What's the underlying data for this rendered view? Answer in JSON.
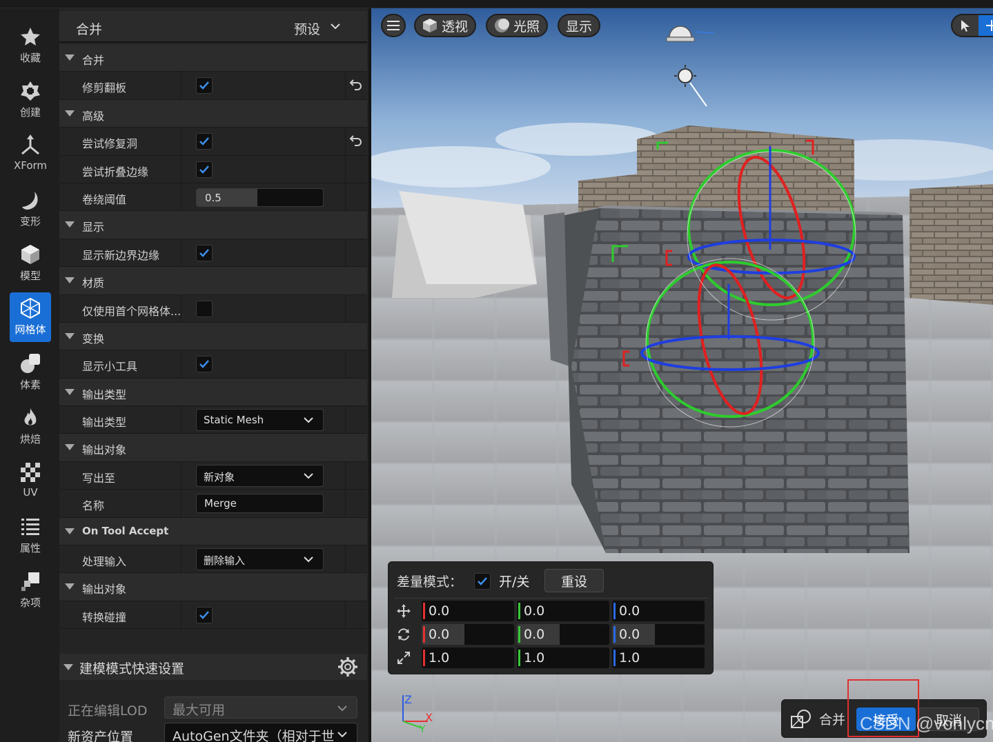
{
  "modes": [
    {
      "label": "收藏",
      "icon": "star-icon"
    },
    {
      "label": "创建",
      "icon": "create-icon"
    },
    {
      "label": "XForm",
      "icon": "xform-icon"
    },
    {
      "label": "变形",
      "icon": "deform-icon"
    },
    {
      "label": "模型",
      "icon": "model-icon"
    },
    {
      "label": "网格体",
      "icon": "mesh-icon",
      "active": true
    },
    {
      "label": "体素",
      "icon": "voxel-icon"
    },
    {
      "label": "烘焙",
      "icon": "bake-icon"
    },
    {
      "label": "UV",
      "icon": "uv-icon"
    },
    {
      "label": "属性",
      "icon": "attributes-icon"
    },
    {
      "label": "杂项",
      "icon": "misc-icon"
    }
  ],
  "panel": {
    "title": "合并",
    "preset_label": "预设",
    "rows": [
      {
        "type": "category",
        "label": "合并"
      },
      {
        "type": "checkbox",
        "label": "修剪翻板",
        "checked": true,
        "reset": true
      },
      {
        "type": "category",
        "label": "高级"
      },
      {
        "type": "checkbox",
        "label": "尝试修复洞",
        "checked": true,
        "reset": true
      },
      {
        "type": "checkbox",
        "label": "尝试折叠边缘",
        "checked": true
      },
      {
        "type": "number",
        "label": "卷绕阈值",
        "value": "0.5",
        "fraction": 0.48
      },
      {
        "type": "category",
        "label": "显示"
      },
      {
        "type": "checkbox",
        "label": "显示新边界边缘",
        "checked": true
      },
      {
        "type": "category",
        "label": "材质"
      },
      {
        "type": "checkbox",
        "label": "仅使用首个网格体...",
        "checked": false
      },
      {
        "type": "category",
        "label": "变换"
      },
      {
        "type": "checkbox",
        "label": "显示小工具",
        "checked": true
      },
      {
        "type": "category",
        "label": "输出类型"
      },
      {
        "type": "combo",
        "label": "输出类型",
        "value": "Static Mesh"
      },
      {
        "type": "category",
        "label": "输出对象"
      },
      {
        "type": "combo",
        "label": "写出至",
        "value": "新对象"
      },
      {
        "type": "text",
        "label": "名称",
        "value": "Merge"
      },
      {
        "type": "category",
        "label": "On Tool Accept",
        "bold": true
      },
      {
        "type": "combo",
        "label": "处理输入",
        "value": "删除输入"
      },
      {
        "type": "category",
        "label": "输出对象"
      },
      {
        "type": "checkbox",
        "label": "转换碰撞",
        "checked": true
      }
    ],
    "quick_settings": {
      "title": "建模模式快速设置",
      "editing_lod_label": "正在编辑LOD",
      "editing_lod_value": "最大可用",
      "asset_location_label": "新资产位置",
      "asset_location_value": "AutoGen文件夹（相对于世"
    }
  },
  "viewport": {
    "buttons": {
      "perspective": "透视",
      "lighting": "光照",
      "show": "显示"
    },
    "delta": {
      "label": "差量模式：",
      "checked": true,
      "toggle_label": "开/关",
      "reset_label": "重设",
      "location": [
        "0.0",
        "0.0",
        "0.0"
      ],
      "rotation": [
        "0.0",
        "0.0",
        "0.0"
      ],
      "scale": [
        "1.0",
        "1.0",
        "1.0"
      ]
    },
    "accept_bar": {
      "label": "合并",
      "accept": "接受",
      "cancel": "取消"
    },
    "axis_labels": {
      "z": "Z",
      "x": "X",
      "y": "Y"
    },
    "watermark": "CSDN @vonlycn"
  },
  "colors": {
    "accent": "#1a6fd6",
    "axis_x": "#e63030",
    "axis_y": "#38c838",
    "axis_z": "#2a5ae6",
    "highlight": "#e03030"
  }
}
